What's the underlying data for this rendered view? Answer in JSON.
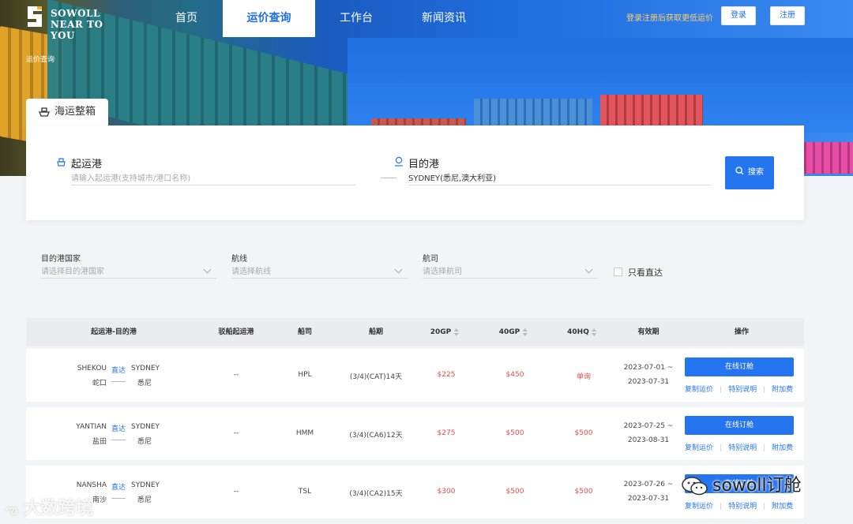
{
  "brand": {
    "line1": "SOWOLL",
    "line2": "NEAR TO YOU",
    "accent": "#1f6fe5"
  },
  "nav": {
    "items": [
      {
        "label": "首页"
      },
      {
        "label": "运价查询"
      },
      {
        "label": "工作台"
      },
      {
        "label": "新闻资讯"
      }
    ],
    "active": "运价查询",
    "promo": "登录注册后获取更低运价",
    "login": "登录",
    "register": "注册"
  },
  "breadcrumb": "运价查询",
  "tab": {
    "label": "海运整箱"
  },
  "search": {
    "origin_label": "起运港",
    "origin_placeholder": "请输入起运港(支持城市/港口名称)",
    "dest_label": "目的港",
    "dest_value": "SYDNEY(悉尼,澳大利亚)",
    "button": "搜索"
  },
  "filters": {
    "country_label": "目的港国家",
    "country_placeholder": "请选择目的港国家",
    "route_label": "航线",
    "route_placeholder": "请选择航线",
    "carrier_label": "航司",
    "carrier_placeholder": "请选择航司",
    "direct_only": "只看直达"
  },
  "table": {
    "headers": {
      "route": "起运港-目的港",
      "feeder": "驳船起运港",
      "carrier": "船司",
      "schedule": "船期",
      "gp20": "20GP",
      "gp40": "40GP",
      "hq40": "40HQ",
      "validity": "有效期",
      "action": "操作"
    },
    "rows": [
      {
        "pol": "SHEKOU",
        "pol_cn": "蛇口",
        "direct": "直达",
        "pod": "SYDNEY",
        "pod_cn": "悉尼",
        "feeder": "--",
        "carrier": "HPL",
        "schedule": "(3/4)(CAT)14天",
        "gp20": "$225",
        "gp40": "$450",
        "hq40": "单询",
        "valid_from": "2023-07-01 ~",
        "valid_to": "2023-07-31"
      },
      {
        "pol": "YANTIAN",
        "pol_cn": "盐田",
        "direct": "直达",
        "pod": "SYDNEY",
        "pod_cn": "悉尼",
        "feeder": "--",
        "carrier": "HMM",
        "schedule": "(3/4)(CA6)12天",
        "gp20": "$275",
        "gp40": "$500",
        "hq40": "$500",
        "valid_from": "2023-07-25 ~",
        "valid_to": "2023-08-31"
      },
      {
        "pol": "NANSHA",
        "pol_cn": "南沙",
        "direct": "直达",
        "pod": "SYDNEY",
        "pod_cn": "悉尼",
        "feeder": "--",
        "carrier": "TSL",
        "schedule": "(3/4)(CA2)15天",
        "gp20": "$300",
        "gp40": "$500",
        "hq40": "$500",
        "valid_from": "2023-07-26 ~",
        "valid_to": "2023-07-31"
      }
    ],
    "book_label": "在线订舱",
    "copy_label": "复制运价",
    "note_label": "特别说明",
    "surcharge_label": "附加费"
  },
  "watermarks": {
    "left": "大数跨境",
    "right": "sowoll订舱"
  },
  "colors": {
    "primary": "#2675f0",
    "price": "#e84a4a",
    "promo": "#ffcf6a"
  }
}
